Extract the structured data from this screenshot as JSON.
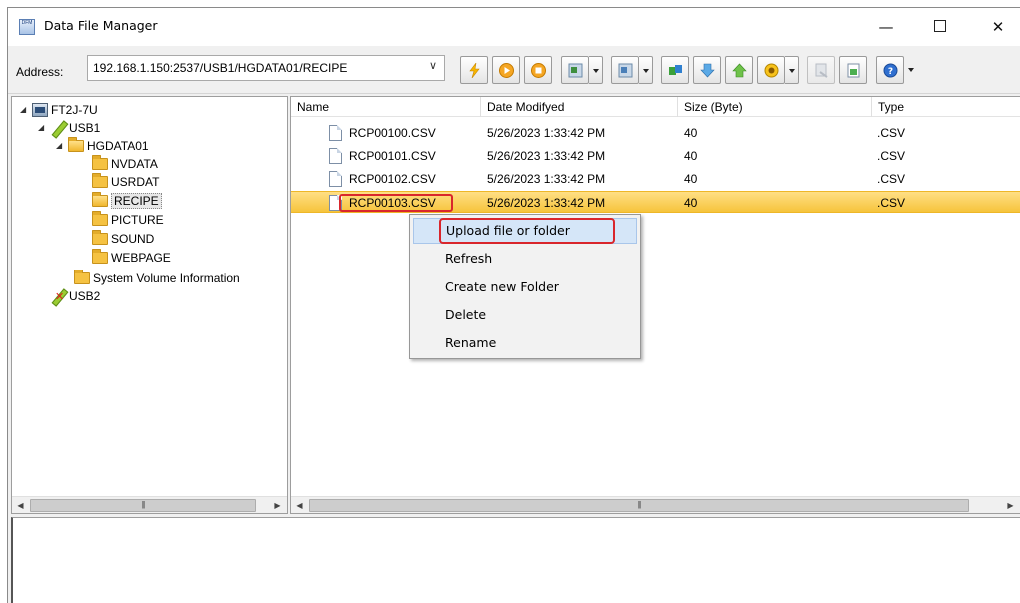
{
  "window": {
    "title": "Data File Manager",
    "app_icon_text": "DFM",
    "minimize_glyph": "—",
    "close_glyph": "✕"
  },
  "toolbar": {
    "address_label": "Address:",
    "address_value": "192.168.1.150:2537/USB1/HGDATA01/RECIPE",
    "buttons": [
      "lightning-icon",
      "play-icon",
      "stop-icon",
      "window-add-icon",
      "window-copy-icon",
      "transfer-icon",
      "down-arrow-icon",
      "up-arrow-icon",
      "settings-icon",
      "disabled-icon",
      "export-icon",
      "help-icon"
    ]
  },
  "tree": {
    "items": [
      {
        "label": "FT2J-7U",
        "type": "drive",
        "expanded": true
      },
      {
        "label": "USB1",
        "type": "usb",
        "expanded": true
      },
      {
        "label": "HGDATA01",
        "type": "folder",
        "expanded": true
      },
      {
        "label": "NVDATA",
        "type": "folder"
      },
      {
        "label": "USRDAT",
        "type": "folder"
      },
      {
        "label": "RECIPE",
        "type": "folder",
        "selected": true
      },
      {
        "label": "PICTURE",
        "type": "folder"
      },
      {
        "label": "SOUND",
        "type": "folder"
      },
      {
        "label": "WEBPAGE",
        "type": "folder"
      },
      {
        "label": "System Volume Information",
        "type": "folder"
      },
      {
        "label": "USB2",
        "type": "usb-disconnected"
      }
    ]
  },
  "file_list": {
    "columns": [
      "Name",
      "Date Modifyed",
      "Size (Byte)",
      "Type"
    ],
    "rows": [
      {
        "name": "RCP00100.CSV",
        "date": "5/26/2023 1:33:42 PM",
        "size": "40",
        "type": ".CSV"
      },
      {
        "name": "RCP00101.CSV",
        "date": "5/26/2023 1:33:42 PM",
        "size": "40",
        "type": ".CSV"
      },
      {
        "name": "RCP00102.CSV",
        "date": "5/26/2023 1:33:42 PM",
        "size": "40",
        "type": ".CSV"
      },
      {
        "name": "RCP00103.CSV",
        "date": "5/26/2023 1:33:42 PM",
        "size": "40",
        "type": ".CSV",
        "selected": true
      }
    ]
  },
  "context_menu": {
    "items": [
      "Upload file or folder",
      "Refresh",
      "Create new Folder",
      "Delete",
      "Rename"
    ],
    "hovered_index": 0
  },
  "scrollbar": {
    "thumb_grip": "|||",
    "left_arrow": "◀",
    "right_arrow": "▶"
  },
  "colors": {
    "selection": "#f6c43c",
    "menu_hover": "#d5e6f8",
    "annotation_red": "#d9262c"
  }
}
